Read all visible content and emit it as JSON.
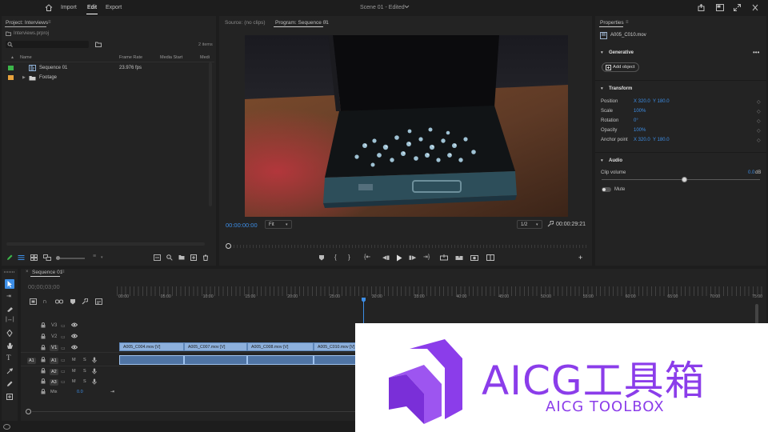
{
  "menubar": {
    "import": "Import",
    "edit": "Edit",
    "export": "Export",
    "doc_title": "Scene 01 - Edited"
  },
  "project": {
    "title": "Project: Interviews",
    "path": "Interviews.prproj",
    "item_count": "2 items",
    "search_placeholder": "",
    "columns": {
      "name": "Name",
      "frame_rate": "Frame Rate",
      "media_start": "Media Start",
      "media": "Medi"
    },
    "items": [
      {
        "name": "Sequence 01",
        "frame_rate": "23.976 fps",
        "color": "#3cb54a"
      },
      {
        "name": "Footage",
        "frame_rate": "",
        "color": "#e8a33d"
      }
    ]
  },
  "monitor": {
    "source_tab": "Source: (no clips)",
    "program_tab": "Program: Sequence 01",
    "timecode": "00:00:00:00",
    "fit": "Fit",
    "resolution": "1/2",
    "duration": "00:00:29:21"
  },
  "properties": {
    "title": "Properties",
    "clip_name": "A005_C010.mov",
    "generative": "Generative",
    "add_object": "Add object",
    "transform": "Transform",
    "position_label": "Position",
    "position_x": "X  320.0",
    "position_y": "Y  180.0",
    "scale_label": "Scale",
    "scale_val": "100%",
    "rotation_label": "Rotation",
    "rotation_val": "0°",
    "opacity_label": "Opacity",
    "opacity_val": "100%",
    "anchor_label": "Anchor point",
    "anchor_x": "X  320.0",
    "anchor_y": "Y  180.0",
    "audio": "Audio",
    "clip_volume_label": "Clip volume",
    "clip_volume_val": "0.0",
    "clip_volume_unit": "dB",
    "mute_label": "Mute"
  },
  "timeline": {
    "tab": "Sequence 01",
    "timecode": "00;00;03;00",
    "ruler": [
      "00:00",
      "05:00",
      "10:00",
      "15:00",
      "20:00",
      "25:00",
      "30:00",
      "35:00",
      "40:00",
      "45:00",
      "50:00",
      "55:00",
      "60:00",
      "65:00",
      "70:00",
      "75:00"
    ],
    "tracks": {
      "v3": "V3",
      "v2": "V2",
      "v1": "V1",
      "a1": "A1",
      "a2": "A2",
      "a3": "A3",
      "mix": "Mix",
      "mix_val": "0.0",
      "a1_src": "A1",
      "v1_src": "V1"
    },
    "video_clips": [
      "A005_C004.mov [V]",
      "A005_C007.mov [V]",
      "A005_C008.mov [V]",
      "A005_C010.mov [V]"
    ]
  },
  "watermark": {
    "title": "AICG工具箱",
    "subtitle": "AICG TOOLBOX",
    "brand_color": "#8b3dea"
  },
  "colors": {
    "accent": "#3d8ee6",
    "playhead": "#3d8ee6",
    "panel": "#232323",
    "background": "#1d1d1d"
  }
}
